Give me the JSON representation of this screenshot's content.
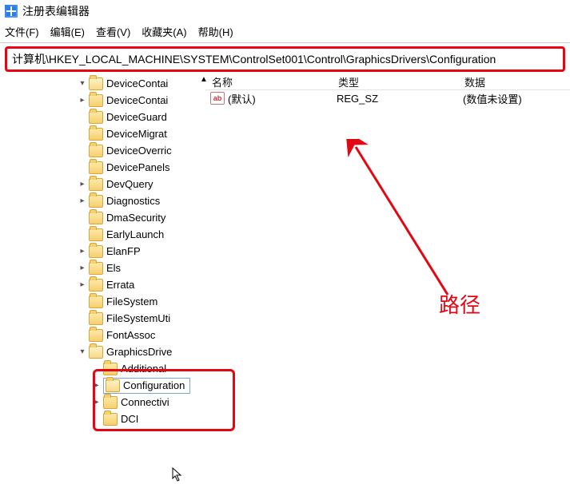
{
  "app": {
    "title": "注册表编辑器"
  },
  "menu": {
    "file": "文件(F)",
    "edit": "编辑(E)",
    "view": "查看(V)",
    "favorites": "收藏夹(A)",
    "help": "帮助(H)"
  },
  "pathbar": "计算机\\HKEY_LOCAL_MACHINE\\SYSTEM\\ControlSet001\\Control\\GraphicsDrivers\\Configuration",
  "tree": {
    "items": [
      {
        "caret": "down",
        "name": "DeviceContai",
        "indent": 1,
        "open": true
      },
      {
        "caret": "right",
        "name": "DeviceContai",
        "indent": 1
      },
      {
        "caret": "",
        "name": "DeviceGuard",
        "indent": 1
      },
      {
        "caret": "",
        "name": "DeviceMigrat",
        "indent": 1
      },
      {
        "caret": "",
        "name": "DeviceOverric",
        "indent": 1
      },
      {
        "caret": "",
        "name": "DevicePanels",
        "indent": 1
      },
      {
        "caret": "right",
        "name": "DevQuery",
        "indent": 1
      },
      {
        "caret": "right",
        "name": "Diagnostics",
        "indent": 1
      },
      {
        "caret": "",
        "name": "DmaSecurity",
        "indent": 1
      },
      {
        "caret": "",
        "name": "EarlyLaunch",
        "indent": 1
      },
      {
        "caret": "right",
        "name": "ElanFP",
        "indent": 1
      },
      {
        "caret": "right",
        "name": "Els",
        "indent": 1
      },
      {
        "caret": "right",
        "name": "Errata",
        "indent": 1
      },
      {
        "caret": "",
        "name": "FileSystem",
        "indent": 1
      },
      {
        "caret": "",
        "name": "FileSystemUti",
        "indent": 1
      },
      {
        "caret": "",
        "name": "FontAssoc",
        "indent": 1
      },
      {
        "caret": "down",
        "name": "GraphicsDrive",
        "indent": 1,
        "open": true
      },
      {
        "caret": "",
        "name": "Additional",
        "indent": 2
      },
      {
        "caret": "right",
        "name": "Configuration",
        "indent": 2,
        "selected": true
      },
      {
        "caret": "right",
        "name": "Connectivi",
        "indent": 2
      },
      {
        "caret": "",
        "name": "DCI",
        "indent": 2
      }
    ]
  },
  "list": {
    "columns": {
      "name": "名称",
      "type": "类型",
      "data": "数据"
    },
    "rows": [
      {
        "icon": "ab",
        "name": "(默认)",
        "type": "REG_SZ",
        "data": "(数值未设置)"
      }
    ]
  },
  "annotation": {
    "label": "路径"
  }
}
